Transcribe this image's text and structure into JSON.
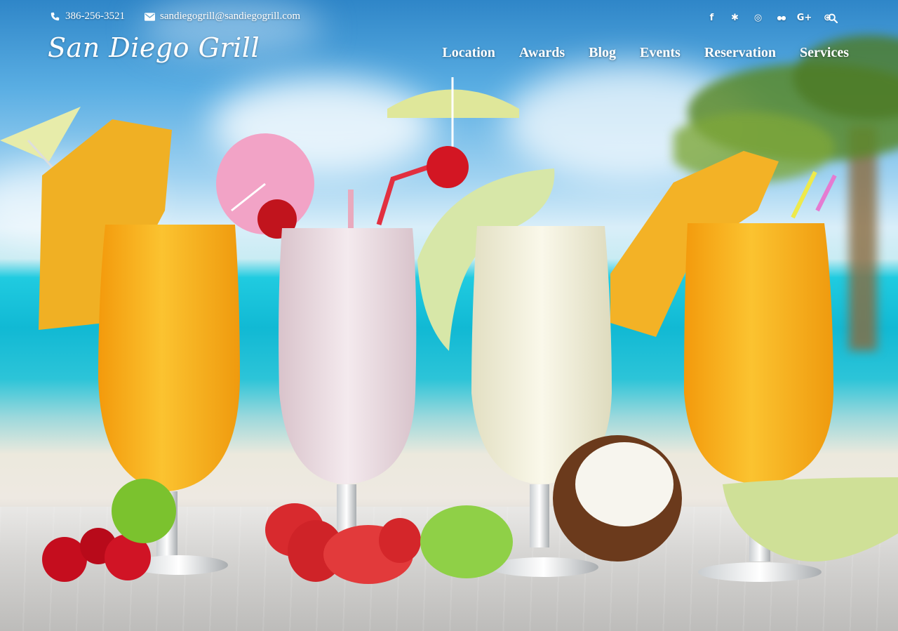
{
  "topbar": {
    "phone": "386-256-3521",
    "email": "sandiegogrill@sandiegogrill.com",
    "social": [
      {
        "icon": "facebook-icon",
        "glyph": "f"
      },
      {
        "icon": "yelp-icon",
        "glyph": "✱"
      },
      {
        "icon": "instagram-icon",
        "glyph": "◎"
      },
      {
        "icon": "flickr-icon",
        "glyph": "●●"
      },
      {
        "icon": "google-plus-icon",
        "glyph": "G+"
      },
      {
        "icon": "dribbble-icon",
        "glyph": "⊛"
      }
    ],
    "search_icon": "search-icon"
  },
  "header": {
    "logo": "San Diego Grill",
    "nav": [
      "Location",
      "Awards",
      "Blog",
      "Events",
      "Reservation",
      "Services"
    ]
  },
  "colors": {
    "text": "#ffffff",
    "sky": "#5aaee3",
    "sea": "#11b9d4",
    "orange_drink": "#f6a515",
    "pink_drink": "#ecdde2",
    "cream_drink": "#f1efd9"
  }
}
